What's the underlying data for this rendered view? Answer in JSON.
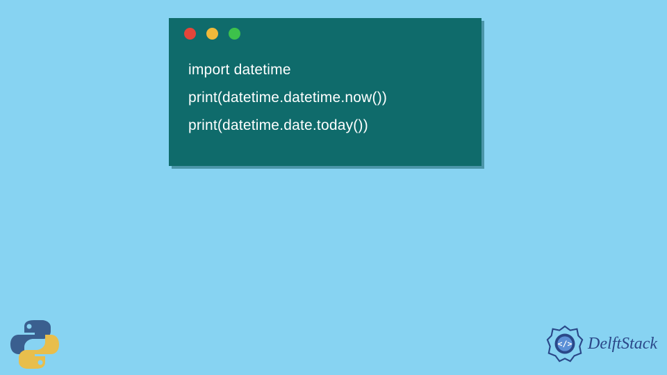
{
  "code": {
    "line1": "import datetime",
    "line2": "print(datetime.datetime.now())",
    "line3": "print(datetime.date.today())"
  },
  "brand": {
    "text": "DelftStack"
  },
  "colors": {
    "background": "#87d3f2",
    "window": "#0f6b6b",
    "red": "#e4453a",
    "yellow": "#f0b93a",
    "green": "#3dc24b",
    "brand": "#2a4788",
    "python_blue": "#3a5f8f",
    "python_yellow": "#e8be4c"
  }
}
